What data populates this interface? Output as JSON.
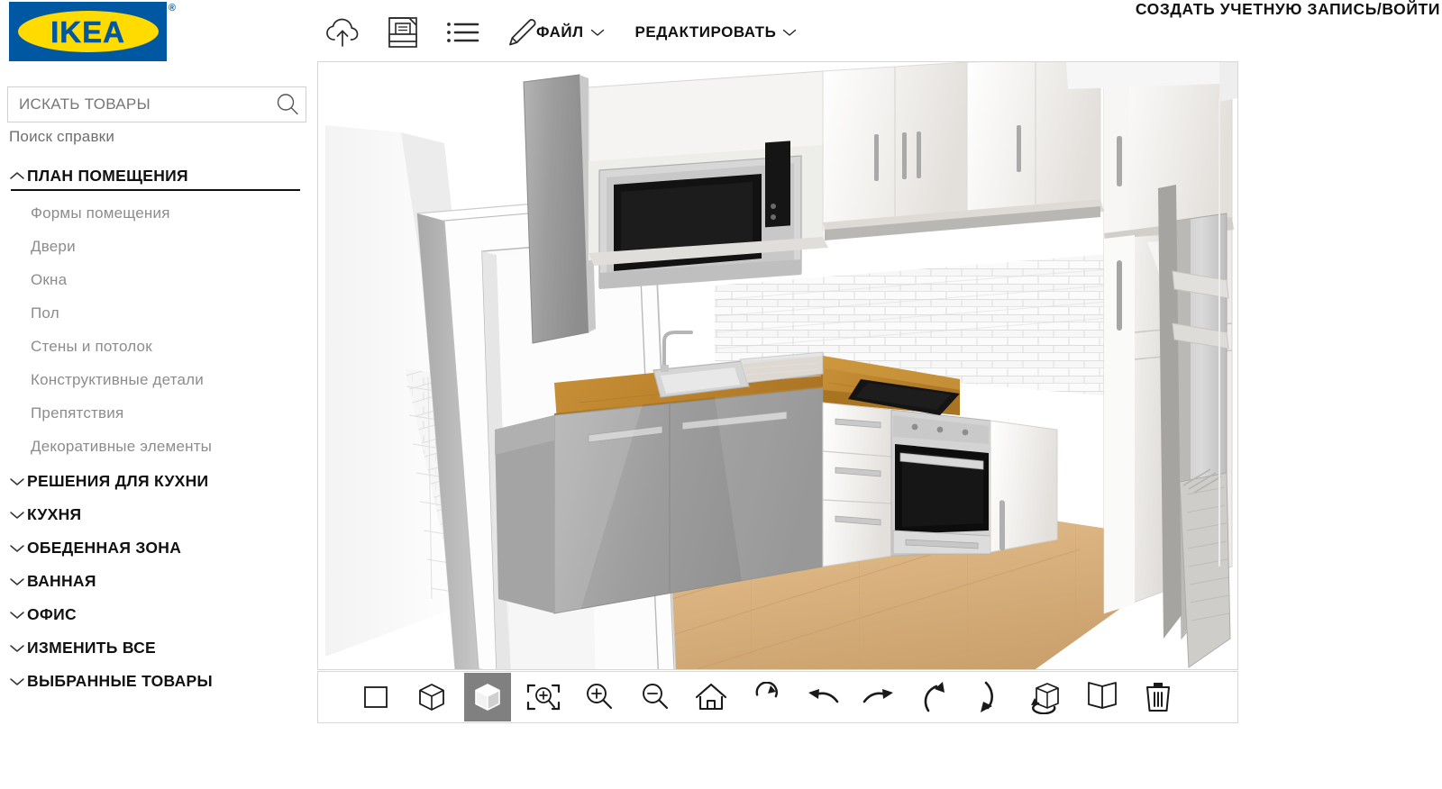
{
  "brand": {
    "name": "IKEA",
    "registered": "®",
    "blue": "#0058a3",
    "yellow": "#ffdb00"
  },
  "header": {
    "account_label": "СОЗДАТЬ УЧЕТНУЮ ЗАПИСЬ/ВОЙТИ",
    "tools": [
      {
        "name": "cloud-upload-icon",
        "title": "Сохранить"
      },
      {
        "name": "print-icon",
        "title": "Печать"
      },
      {
        "name": "list-icon",
        "title": "Список"
      },
      {
        "name": "pencil-icon",
        "title": "Редактировать"
      }
    ],
    "menus": [
      {
        "label": "ФАЙЛ",
        "caret": "chevron-down-icon"
      },
      {
        "label": "РЕДАКТИРОВАТЬ",
        "caret": "chevron-down-icon"
      }
    ]
  },
  "search": {
    "placeholder": "ИСКАТЬ ТОВАРЫ",
    "value": "",
    "icon": "search-icon",
    "help_label": "Поиск справки"
  },
  "sidebar": {
    "sections": [
      {
        "label": "ПЛАН ПОМЕЩЕНИЯ",
        "expanded": true,
        "items": [
          "Формы помещения",
          "Двери",
          "Окна",
          "Пол",
          "Стены и потолок",
          "Конструктивные детали",
          "Препятствия",
          "Декоративные элементы"
        ]
      },
      {
        "label": "РЕШЕНИЯ ДЛЯ КУХНИ",
        "expanded": false,
        "items": []
      },
      {
        "label": "КУХНЯ",
        "expanded": false,
        "items": []
      },
      {
        "label": "ОБЕДЕННАЯ ЗОНА",
        "expanded": false,
        "items": []
      },
      {
        "label": "ВАННАЯ",
        "expanded": false,
        "items": []
      },
      {
        "label": "ОФИС",
        "expanded": false,
        "items": []
      },
      {
        "label": "ИЗМЕНИТЬ ВСЕ",
        "expanded": false,
        "items": []
      },
      {
        "label": "ВЫБРАННЫЕ ТОВАРЫ",
        "expanded": false,
        "items": []
      }
    ]
  },
  "view_toolbar": {
    "active_index": 2,
    "buttons": [
      {
        "name": "view-2d-icon",
        "title": "2D"
      },
      {
        "name": "view-3d-wireframe-icon",
        "title": "3D"
      },
      {
        "name": "view-3d-solid-icon",
        "title": "3D"
      },
      {
        "name": "zoom-to-fit-icon",
        "title": "По размеру"
      },
      {
        "name": "zoom-in-icon",
        "title": "Увеличить"
      },
      {
        "name": "zoom-out-icon",
        "title": "Уменьшить"
      },
      {
        "name": "home-icon",
        "title": "Дом"
      },
      {
        "name": "rotate-reset-icon",
        "title": "Сброс"
      },
      {
        "name": "undo-icon",
        "title": "Отменить"
      },
      {
        "name": "redo-icon",
        "title": "Повторить"
      },
      {
        "name": "tilt-up-icon",
        "title": "Вверх"
      },
      {
        "name": "tilt-down-icon",
        "title": "Вниз"
      },
      {
        "name": "rotate-3d-icon",
        "title": "Вращать"
      },
      {
        "name": "walls-view-icon",
        "title": "Стены"
      },
      {
        "name": "delete-icon",
        "title": "Удалить"
      }
    ]
  },
  "scene": {
    "description": "3D кухня",
    "colors": {
      "floor": "#d9ae7c",
      "countertop": "#c0882f",
      "cabinet_gray": "#9b9b9b",
      "cabinet_white": "#f2f0ee",
      "wall": "#ffffff",
      "tile": "#f4f4f4",
      "appliance_black": "#111111"
    }
  }
}
